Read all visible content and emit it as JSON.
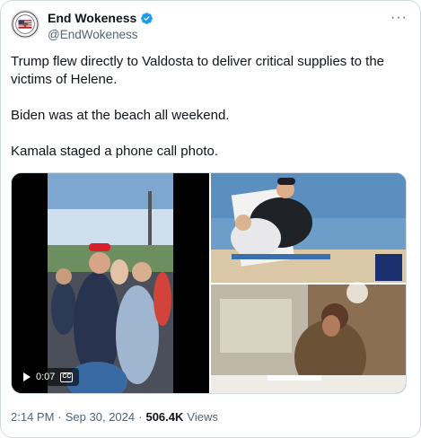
{
  "author": {
    "display_name": "End Wokeness",
    "handle": "@EndWokeness",
    "verified": true,
    "avatar_icon": "circular-seal-avatar"
  },
  "more_icon": "more-options-icon",
  "tweet_text": {
    "line1": "Trump flew directly to Valdosta to deliver critical supplies to the victims of Helene.",
    "line2": "Biden was at the beach all weekend.",
    "line3": "Kamala staged a phone call photo."
  },
  "media": {
    "video": {
      "duration": "0:07",
      "captions_icon": "closed-captions-icon",
      "play_icon": "play-icon"
    },
    "photos": [
      "beach-photo",
      "phone-call-photo"
    ]
  },
  "meta": {
    "time": "2:14 PM",
    "date": "Sep 30, 2024",
    "separator": "·",
    "views_count": "506.4K",
    "views_label": "Views"
  },
  "colors": {
    "verified_blue": "#1d9bf0",
    "secondary_text": "#536471",
    "border": "#cfd9de"
  }
}
